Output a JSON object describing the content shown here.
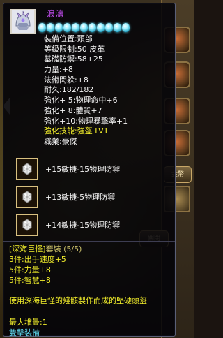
{
  "item": {
    "name": "浪濤",
    "icon": "helmet-icon",
    "stars": 11
  },
  "stats": [
    {
      "label": "裝備位置",
      "sep": ":",
      "value": "頭部",
      "color": "white"
    },
    {
      "label": "等級限制",
      "sep": ":",
      "value": "50   皮革",
      "color": "white"
    },
    {
      "label": "基礎防禦",
      "sep": ":",
      "value": "58+25",
      "color": "white"
    },
    {
      "label": "力量",
      "sep": ":",
      "value": "+8",
      "color": "white"
    },
    {
      "label": "法術閃躲",
      "sep": ":",
      "value": "+8",
      "color": "white"
    },
    {
      "label": "耐久",
      "sep": ":",
      "value": "182/182",
      "color": "white"
    },
    {
      "label": "強化+ 5",
      "sep": ":",
      "value": "物理命中+6",
      "color": "white"
    },
    {
      "label": "強化+ 8",
      "sep": ":",
      "value": "體質+7",
      "color": "white"
    },
    {
      "label": "強化+10",
      "sep": ":",
      "value": "物理暴擊率+1",
      "color": "white"
    },
    {
      "label": "強化技能",
      "sep": ":",
      "value": "強盔   LV1",
      "color": "yellow"
    },
    {
      "label": "職業",
      "sep": ":",
      "value": "豪傑",
      "color": "white"
    }
  ],
  "gems": [
    {
      "icon": "gem-icon",
      "text": "+15敏捷-15物理防禦"
    },
    {
      "icon": "gem-icon",
      "text": "+13敏捷-5物理防禦"
    },
    {
      "icon": "gem-icon",
      "text": "+14敏捷-15物理防禦"
    }
  ],
  "set": {
    "title_prefix": "[深海巨怪]",
    "title_suffix": "套裝 (5/5)",
    "bonuses": [
      "3件:出手速度+5",
      "5件:力量+8",
      "5件:智慧+8"
    ]
  },
  "description": "使用深海巨怪的殘骸製作而成的堅硬頭盔",
  "stack": "最大堆疊:1",
  "binding": "雙擊裝備",
  "background": {
    "buttons": [
      "金幣",
      "關閉"
    ]
  },
  "colors": {
    "name": "#c34df0",
    "yellow_text": "#f2ee2b",
    "binding": "#5ed6ec",
    "tooltip_bg": "#020208"
  }
}
